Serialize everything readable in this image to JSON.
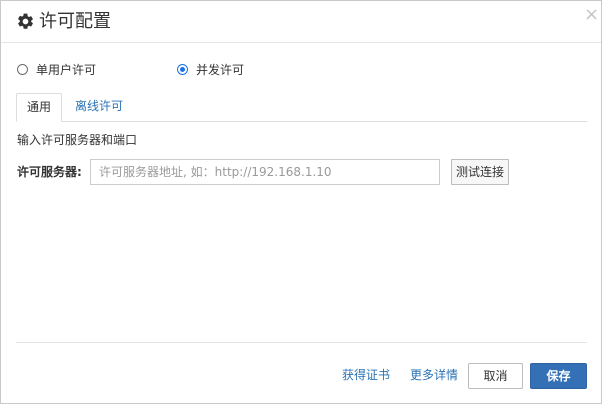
{
  "dialog": {
    "title": "许可配置",
    "close_symbol": "×",
    "icons": {
      "title_icon": "gear-icon",
      "close_icon": "close-icon"
    }
  },
  "license_type": {
    "options": [
      {
        "label": "单用户许可",
        "checked": false
      },
      {
        "label": "并发许可",
        "checked": true
      }
    ]
  },
  "tabs": [
    {
      "label": "通用",
      "active": true
    },
    {
      "label": "离线许可",
      "active": false
    }
  ],
  "general": {
    "hint": "输入许可服务器和端口",
    "server_label": "许可服务器:",
    "server_value": "",
    "server_placeholder": "许可服务器地址, 如：http://192.168.1.10",
    "test_button": "测试连接"
  },
  "footer": {
    "get_certificate": "获得证书",
    "more_details": "更多详情",
    "cancel": "取消",
    "save": "保存"
  },
  "colors": {
    "accent": "#3370b5",
    "link": "#2a72b5",
    "radio_checked": "#1a73e8"
  }
}
